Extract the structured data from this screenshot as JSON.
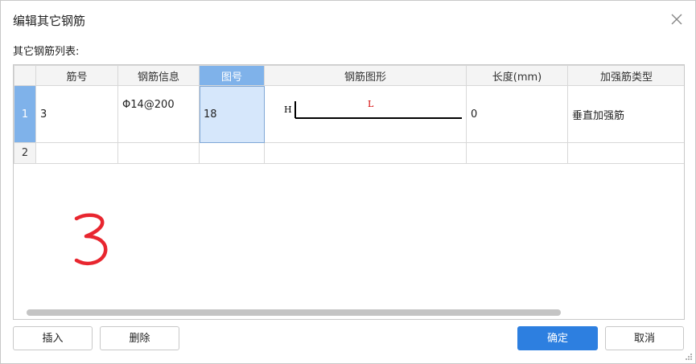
{
  "dialog": {
    "title": "编辑其它钢筋",
    "list_label": "其它钢筋列表:"
  },
  "table": {
    "columns": [
      "筋号",
      "钢筋信息",
      "图号",
      "钢筋图形",
      "长度(mm)",
      "加强筋类型"
    ],
    "active_column": "图号",
    "rows": [
      {
        "index": "1",
        "bar_no": "3",
        "bar_info": "Φ14@200",
        "figure_no": "18",
        "shape_h": "H",
        "shape_l": "L",
        "length": "0",
        "type": "垂直加强筋"
      },
      {
        "index": "2",
        "bar_no": "",
        "bar_info": "",
        "figure_no": "",
        "shape_h": "",
        "shape_l": "",
        "length": "",
        "type": ""
      }
    ]
  },
  "annotation": {
    "scribble_color": "#e8262f"
  },
  "buttons": {
    "insert": "插入",
    "delete": "删除",
    "ok": "确定",
    "cancel": "取消"
  },
  "colors": {
    "accent": "#2d7fe0",
    "header_active": "#7fb2ea",
    "cell_selected": "#d6e7fb"
  }
}
